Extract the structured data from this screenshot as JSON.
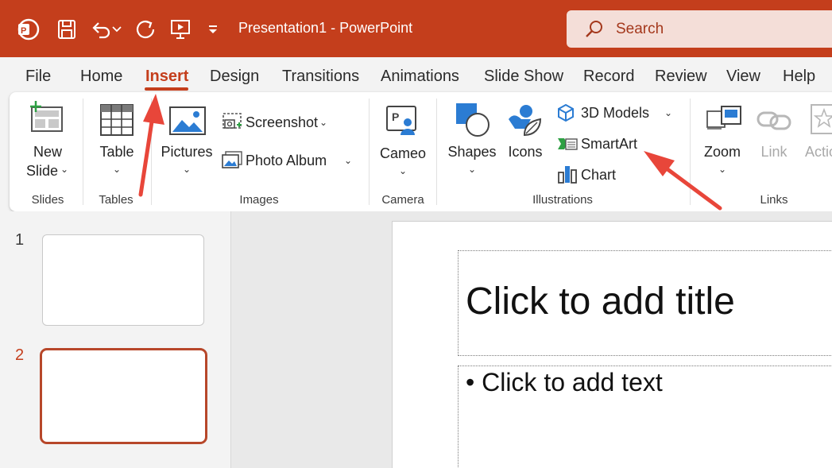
{
  "titlebar": {
    "title": "Presentation1  -  PowerPoint",
    "search_placeholder": "Search",
    "color": "#c43e1c",
    "icons": [
      "powerpoint-logo-icon",
      "save-icon",
      "undo-icon",
      "undo-dropdown-icon",
      "redo-icon",
      "present-icon",
      "customize-qat-icon"
    ]
  },
  "menu": {
    "tabs": [
      "File",
      "Home",
      "Insert",
      "Design",
      "Transitions",
      "Animations",
      "Slide Show",
      "Record",
      "Review",
      "View",
      "Help"
    ],
    "active": "Insert"
  },
  "ribbon": {
    "slides": {
      "new_slide_line1": "New",
      "new_slide_line2": "Slide",
      "group": "Slides"
    },
    "tables": {
      "table": "Table",
      "group": "Tables"
    },
    "images": {
      "pictures": "Pictures",
      "screenshot": "Screenshot",
      "photo_album": "Photo Album",
      "group": "Images"
    },
    "camera": {
      "cameo": "Cameo",
      "group": "Camera"
    },
    "illustrations": {
      "shapes": "Shapes",
      "icons": "Icons",
      "models_3d": "3D Models",
      "smartart": "SmartArt",
      "chart": "Chart",
      "group": "Illustrations"
    },
    "links": {
      "zoom": "Zoom",
      "link": "Link",
      "action": "Actio",
      "group": "Links"
    },
    "chevron": "⌄"
  },
  "thumbnails": {
    "slides": [
      {
        "number": "1"
      },
      {
        "number": "2",
        "selected": true
      }
    ]
  },
  "slide": {
    "title_placeholder": "Click to add title",
    "body_placeholder": "• Click to add text"
  },
  "annotations": {
    "arrow_color": "#e8463a",
    "targets": [
      "Insert tab",
      "SmartArt"
    ]
  }
}
